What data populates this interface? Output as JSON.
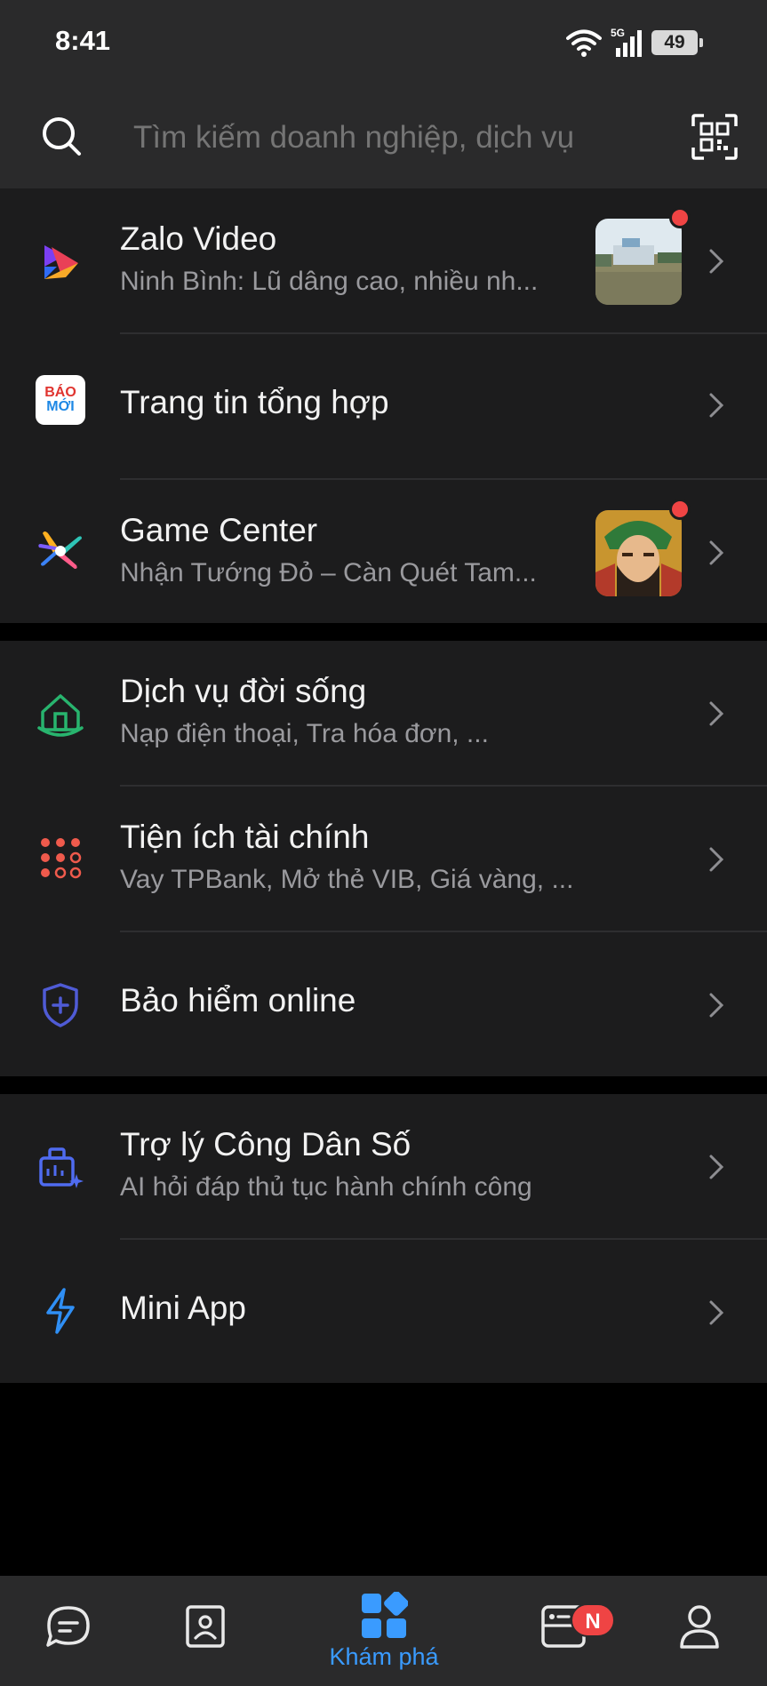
{
  "status": {
    "time": "8:41",
    "network": "5G",
    "battery": "49"
  },
  "search": {
    "placeholder": "Tìm kiếm doanh nghiệp, dịch vụ"
  },
  "sections": [
    [
      {
        "title": "Zalo Video",
        "subtitle": "Ninh Bình: Lũ dâng cao, nhiều nh...",
        "icon": "zalo-video-icon",
        "has_thumbnail": true,
        "has_red_dot": true
      },
      {
        "title": "Trang tin tổng hợp",
        "subtitle": "",
        "icon": "bao-moi-icon",
        "icon_text_top": "BÁO",
        "icon_text_bottom": "MỚI"
      },
      {
        "title": "Game Center",
        "subtitle": "Nhận Tướng Đỏ – Càn Quét Tam...",
        "icon": "game-center-icon",
        "has_thumbnail": true,
        "has_red_dot": true
      }
    ],
    [
      {
        "title": "Dịch vụ đời sống",
        "subtitle": "Nạp điện thoại, Tra hóa đơn, ...",
        "icon": "home-services-icon"
      },
      {
        "title": "Tiện ích tài chính",
        "subtitle": "Vay TPBank, Mở thẻ VIB, Giá vàng, ...",
        "icon": "finance-dots-icon"
      },
      {
        "title": "Bảo hiểm online",
        "subtitle": "",
        "icon": "insurance-shield-icon"
      }
    ],
    [
      {
        "title": "Trợ lý Công Dân Số",
        "subtitle": "AI hỏi đáp thủ tục hành chính công",
        "icon": "citizen-assistant-icon"
      },
      {
        "title": "Mini App",
        "subtitle": "",
        "icon": "lightning-icon"
      }
    ]
  ],
  "bottom_nav": {
    "items": [
      {
        "icon": "chat-icon",
        "label": ""
      },
      {
        "icon": "contacts-icon",
        "label": ""
      },
      {
        "icon": "discover-icon",
        "label": "Khám phá",
        "active": true
      },
      {
        "icon": "timeline-icon",
        "label": "",
        "badge": "N"
      },
      {
        "icon": "profile-icon",
        "label": ""
      }
    ]
  },
  "colors": {
    "accent": "#3a9bff",
    "red_dot": "#ef4444",
    "background": "#1c1c1d"
  }
}
